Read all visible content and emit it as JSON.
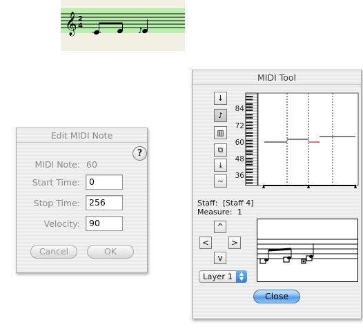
{
  "staff_snippet": {
    "band_color": "#b9efad",
    "background": "#f3f1e4"
  },
  "edit_dialog": {
    "title": "Edit MIDI Note",
    "help": "?",
    "midi_note_label": "MIDI Note:",
    "midi_note_value": "60",
    "start_time_label": "Start Time:",
    "start_time_value": "0",
    "stop_time_label": "Stop Time:",
    "stop_time_value": "256",
    "velocity_label": "Velocity:",
    "velocity_value": "90",
    "cancel_label": "Cancel",
    "ok_label": "OK"
  },
  "midi_tool": {
    "title": "MIDI Tool",
    "tools": [
      {
        "name": "down-arrow-tool-icon",
        "glyph": "↓"
      },
      {
        "name": "note-tool-icon",
        "glyph": "♪"
      },
      {
        "name": "grid-tool-icon",
        "glyph": "▥"
      },
      {
        "name": "copy-tool-icon",
        "glyph": "⧉"
      },
      {
        "name": "down-to-line-tool-icon",
        "glyph": "⤓"
      },
      {
        "name": "tilde-tool-icon",
        "glyph": "~"
      }
    ],
    "pitch_labels": [
      "84",
      "72",
      "60",
      "48",
      "36"
    ],
    "staff_label": "Staff:",
    "staff_value": "[Staff 4]",
    "measure_label": "Measure:",
    "measure_value": "1",
    "nav": {
      "up": "^",
      "left": "<",
      "right": ">",
      "down": "v"
    },
    "layer_value": "Layer 1",
    "close_label": "Close",
    "selected_note_color": "#cc2222"
  }
}
